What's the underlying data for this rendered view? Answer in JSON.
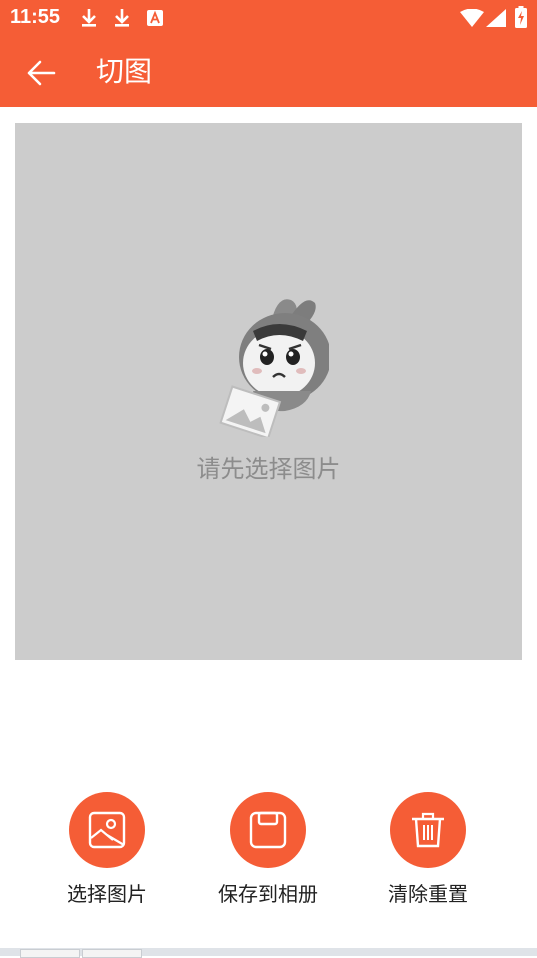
{
  "status_bar": {
    "time": "11:55",
    "icons": [
      "download-icon",
      "download-icon",
      "text-a-icon",
      "wifi-icon",
      "signal-icon",
      "battery-icon"
    ]
  },
  "app_bar": {
    "title": "切图",
    "back_icon": "arrow-left-icon"
  },
  "canvas": {
    "placeholder_text": "请先选择图片",
    "background": "#cccccc"
  },
  "actions": [
    {
      "label": "选择图片",
      "icon": "image-icon"
    },
    {
      "label": "保存到相册",
      "icon": "save-icon"
    },
    {
      "label": "清除重置",
      "icon": "trash-icon"
    }
  ],
  "colors": {
    "accent": "#f55d36",
    "canvas_bg": "#cccccc",
    "hint_text": "#8c8c8c"
  }
}
